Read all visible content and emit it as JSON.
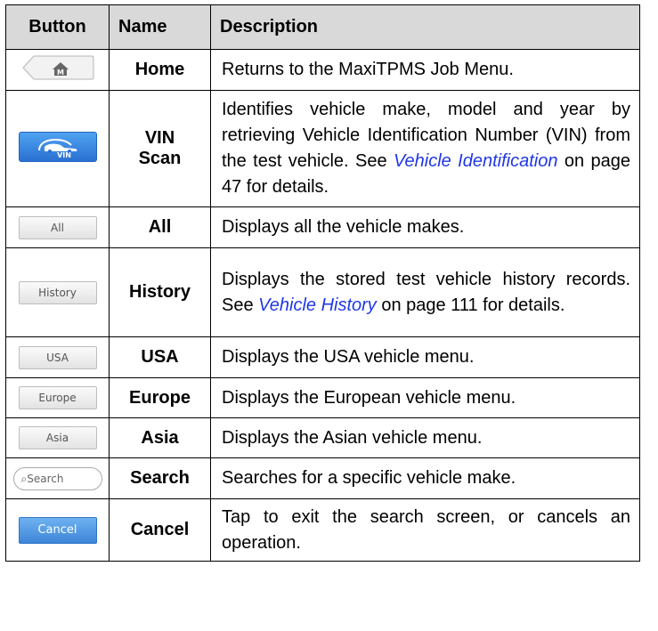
{
  "header": {
    "button": "Button",
    "name": "Name",
    "description": "Description"
  },
  "rows": [
    {
      "icon": "home-icon",
      "name": "Home",
      "desc": "Returns to the MaxiTPMS Job Menu."
    },
    {
      "icon": "vin-scan-icon",
      "icon_text": "VIN",
      "name1": "VIN",
      "name2": "Scan",
      "desc_a": "Identifies vehicle make, model and year by retrieving Vehicle Identification Number (VIN) from the test vehicle. See ",
      "link": "Vehicle Identification",
      "desc_b": " on page 47 for details."
    },
    {
      "btn": "All",
      "name": "All",
      "desc": "Displays all the vehicle makes."
    },
    {
      "btn": "History",
      "name": "History",
      "desc_a": "Displays the stored test vehicle history records. See ",
      "link": "Vehicle History",
      "desc_b": " on page 111 for details."
    },
    {
      "btn": "USA",
      "name": "USA",
      "desc": "Displays the USA vehicle menu."
    },
    {
      "btn": "Europe",
      "name": "Europe",
      "desc": "Displays the European vehicle menu."
    },
    {
      "btn": "Asia",
      "name": "Asia",
      "desc": "Displays the Asian vehicle menu."
    },
    {
      "btn": "Search",
      "name": "Search",
      "desc": "Searches for a specific vehicle make."
    },
    {
      "btn": "Cancel",
      "name": "Cancel",
      "desc": "Tap to exit the search screen, or cancels an operation."
    }
  ],
  "colors": {
    "header_bg": "#d9d9d9",
    "link": "#1f37e6",
    "vin_button": "#3b86e0",
    "cancel_button": "#4a8fdc"
  }
}
